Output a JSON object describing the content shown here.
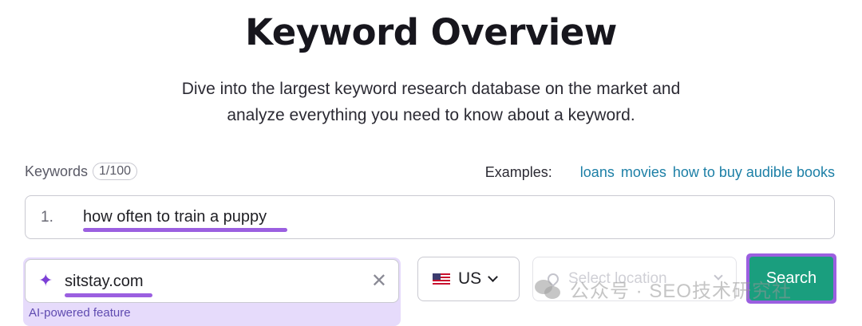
{
  "header": {
    "title": "Keyword Overview",
    "subtitle_line1": "Dive into the largest keyword research database on the market and",
    "subtitle_line2": "analyze everything you need to know about a keyword."
  },
  "keywords": {
    "label": "Keywords",
    "count": "1/100",
    "examples_label": "Examples:",
    "examples": [
      "loans",
      "movies",
      "how to buy audible books"
    ],
    "items": [
      {
        "number": "1.",
        "text": "how often to train a puppy"
      }
    ]
  },
  "domain": {
    "value": "sitstay.com",
    "clear_icon": "close-icon",
    "ai_label": "AI-powered feature"
  },
  "country": {
    "code": "US",
    "flag": "us-flag-icon"
  },
  "location": {
    "placeholder": "Select location"
  },
  "search": {
    "label": "Search"
  },
  "watermark": {
    "text": "公众号 · SEO技术研究社"
  },
  "colors": {
    "accent_purple": "#9b5fe0",
    "search_green": "#1a9e7e",
    "link_blue": "#1c7fa6",
    "ai_bg": "#e6dbfb"
  }
}
